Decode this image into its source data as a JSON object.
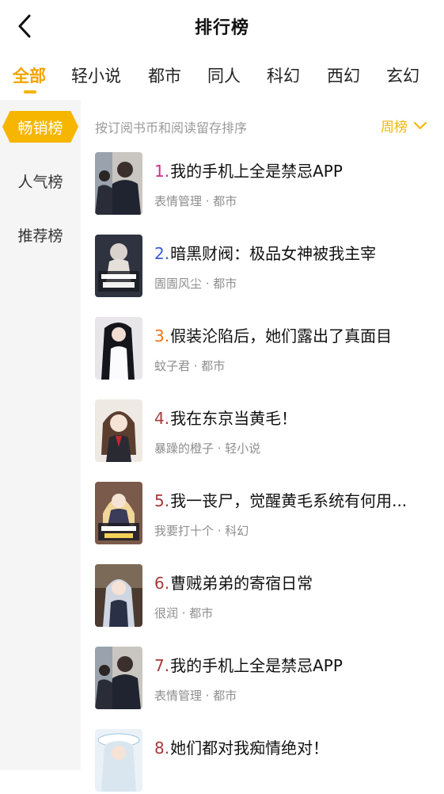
{
  "header": {
    "title": "排行榜",
    "back_icon": "chevron-left-icon"
  },
  "tabs": [
    {
      "label": "全部",
      "active": true
    },
    {
      "label": "轻小说"
    },
    {
      "label": "都市"
    },
    {
      "label": "同人"
    },
    {
      "label": "科幻"
    },
    {
      "label": "西幻"
    },
    {
      "label": "玄幻"
    }
  ],
  "sidebar": {
    "items": [
      {
        "label": "畅销榜",
        "active": true
      },
      {
        "label": "人气榜"
      },
      {
        "label": "推荐榜"
      }
    ]
  },
  "subheader": {
    "sort_hint": "按订阅书币和阅读留存排序",
    "period": "周榜",
    "period_icon": "chevron-down-icon"
  },
  "books": [
    {
      "rank": "1.",
      "title": "我的手机上全是禁忌APP",
      "meta": "表情管理 · 都市",
      "rank_color": "#d6288a"
    },
    {
      "rank": "2.",
      "title": "暗黑财阀：极品女神被我主宰",
      "meta": "圊圊风尘 · 都市",
      "rank_color": "#3a5bd9"
    },
    {
      "rank": "3.",
      "title": "假装沦陷后，她们露出了真面目",
      "meta": "蚊子君 · 都市",
      "rank_color": "#f0731a"
    },
    {
      "rank": "4.",
      "title": "我在东京当黄毛！",
      "meta": "暴躁的橙子 · 轻小说",
      "rank_color": "#a8393a"
    },
    {
      "rank": "5.",
      "title": "我一丧尸，觉醒黄毛系统有何用...",
      "meta": "我要打十个 · 科幻",
      "rank_color": "#a8393a"
    },
    {
      "rank": "6.",
      "title": "曹贼弟弟的寄宿日常",
      "meta": "很润 · 都市",
      "rank_color": "#a8393a"
    },
    {
      "rank": "7.",
      "title": "我的手机上全是禁忌APP",
      "meta": "表情管理 · 都市",
      "rank_color": "#a8393a"
    },
    {
      "rank": "8.",
      "title": "她们都对我痴情绝对！",
      "meta": "",
      "rank_color": "#a8393a"
    }
  ],
  "colors": {
    "accent": "#f5b400",
    "sidebar_bg": "#f5f5f5"
  }
}
